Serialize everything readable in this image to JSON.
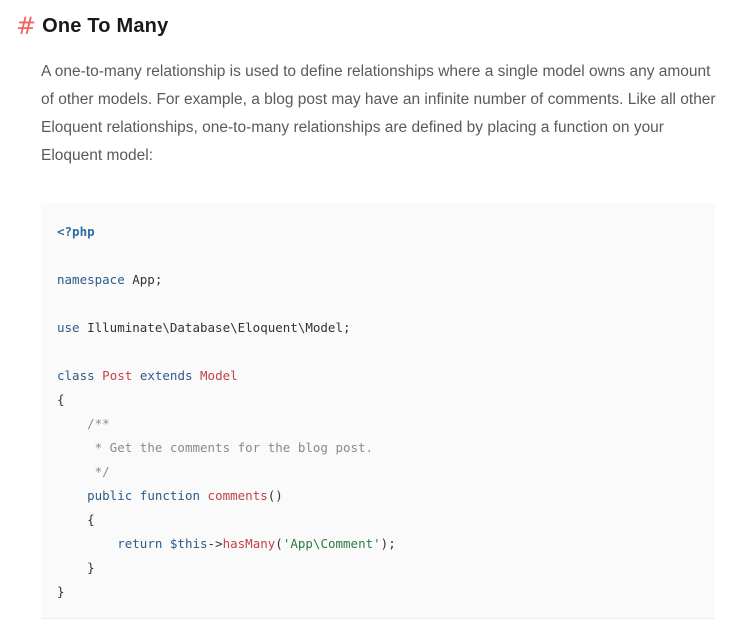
{
  "heading": {
    "hash": "#",
    "title": "One To Many"
  },
  "paragraph": "A one-to-many relationship is used to define relationships where a single model owns any amount of other models. For example, a blog post may have an infinite number of comments. Like all other Eloquent relationships, one-to-many relationships are defined by placing a function on your Eloquent model:",
  "code": {
    "open_tag": "<?php",
    "namespace_kw": "namespace",
    "namespace_name": " App;",
    "use_kw": "use",
    "use_path": " Illuminate\\Database\\Eloquent\\Model;",
    "class_kw": "class",
    "class_name": "Post",
    "extends_kw": "extends",
    "parent_class": "Model",
    "open_brace": "{",
    "comment_start": "/**",
    "comment_body": " * Get the comments for the blog post.",
    "comment_end": " */",
    "public_kw": "public",
    "function_kw": "function",
    "method_name": "comments",
    "method_parens": "()",
    "method_open": "{",
    "return_kw": "return",
    "this_var": "$this",
    "arrow": "->",
    "call_name": "hasMany",
    "call_open": "(",
    "call_arg": "'App\\Comment'",
    "call_close": ");",
    "method_close": "}",
    "close_brace": "}"
  }
}
